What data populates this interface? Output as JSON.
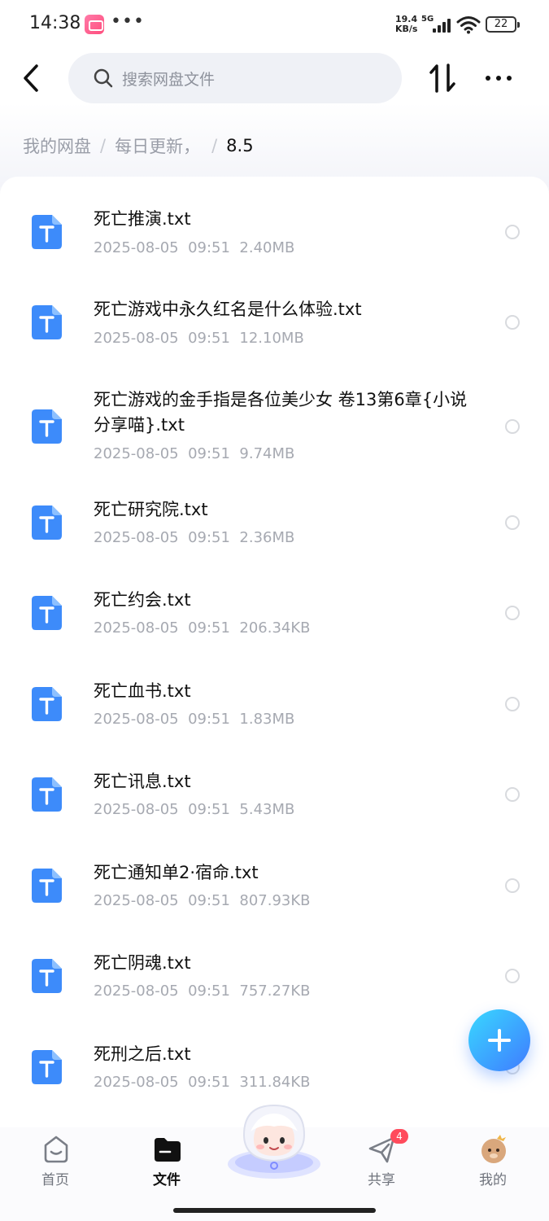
{
  "status_bar": {
    "time": "14:38",
    "dots": "•••",
    "network_speed_value": "19.4",
    "network_speed_unit": "KB/s",
    "network_type": "5G",
    "battery": "22"
  },
  "header": {
    "search_placeholder": "搜索网盘文件"
  },
  "breadcrumb": {
    "items": [
      "我的网盘",
      "每日更新，"
    ],
    "separator": "/",
    "current": "8.5"
  },
  "files": [
    {
      "name": "死亡推演.txt",
      "date": "2025-08-05",
      "time": "09:51",
      "size": "2.40MB"
    },
    {
      "name": "死亡游戏中永久红名是什么体验.txt",
      "date": "2025-08-05",
      "time": "09:51",
      "size": "12.10MB"
    },
    {
      "name": "死亡游戏的金手指是各位美少女 卷13第6章{小说分享喵}.txt",
      "date": "2025-08-05",
      "time": "09:51",
      "size": "9.74MB"
    },
    {
      "name": "死亡研究院.txt",
      "date": "2025-08-05",
      "time": "09:51",
      "size": "2.36MB"
    },
    {
      "name": "死亡约会.txt",
      "date": "2025-08-05",
      "time": "09:51",
      "size": "206.34KB"
    },
    {
      "name": "死亡血书.txt",
      "date": "2025-08-05",
      "time": "09:51",
      "size": "1.83MB"
    },
    {
      "name": "死亡讯息.txt",
      "date": "2025-08-05",
      "time": "09:51",
      "size": "5.43MB"
    },
    {
      "name": "死亡通知单2·宿命.txt",
      "date": "2025-08-05",
      "time": "09:51",
      "size": "807.93KB"
    },
    {
      "name": "死亡阴魂.txt",
      "date": "2025-08-05",
      "time": "09:51",
      "size": "757.27KB"
    },
    {
      "name": "死刑之后.txt",
      "date": "2025-08-05",
      "time": "09:51",
      "size": "311.84KB"
    }
  ],
  "file_icon_letter": "T",
  "bottom_nav": {
    "home": "首页",
    "files": "文件",
    "share": "共享",
    "share_badge": "4",
    "mine": "我的",
    "active": "files"
  },
  "colors": {
    "accent": "#3f7bff",
    "file_icon": "#3d8bfa",
    "badge": "#ff4b5c"
  }
}
